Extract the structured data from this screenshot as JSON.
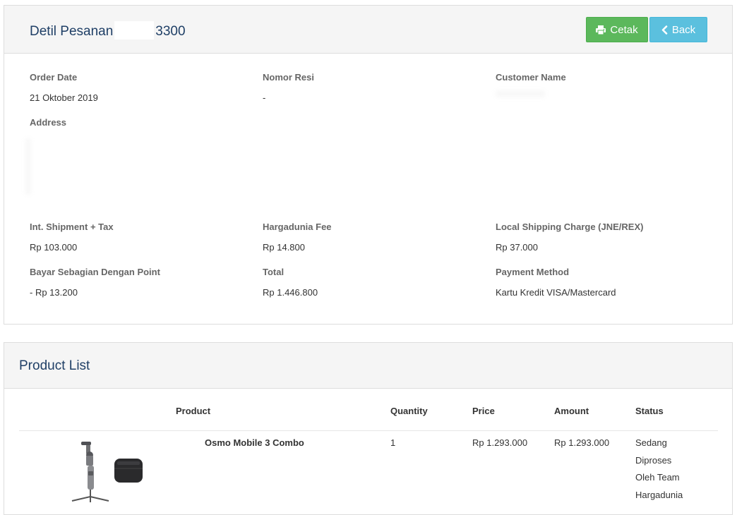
{
  "order": {
    "title_prefix": "Detil Pesanan",
    "title_suffix": "3300",
    "buttons": {
      "print_label": "Cetak",
      "back_label": "Back"
    },
    "fields": {
      "order_date_label": "Order Date",
      "order_date_value": "21 Oktober 2019",
      "nomor_resi_label": "Nomor Resi",
      "nomor_resi_value": "-",
      "customer_name_label": "Customer Name",
      "address_label": "Address",
      "int_shipment_label": "Int. Shipment + Tax",
      "int_shipment_value": "Rp 103.000",
      "hargadunia_fee_label": "Hargadunia Fee",
      "hargadunia_fee_value": "Rp 14.800",
      "local_shipping_label": "Local Shipping Charge (JNE/REX)",
      "local_shipping_value": "Rp 37.000",
      "points_label": "Bayar Sebagian Dengan Point",
      "points_value": "- Rp 13.200",
      "total_label": "Total",
      "total_value": "Rp 1.446.800",
      "payment_label": "Payment Method",
      "payment_value": "Kartu Kredit VISA/Mastercard"
    }
  },
  "products": {
    "title": "Product List",
    "columns": [
      "Product",
      "Quantity",
      "Price",
      "Amount",
      "Status"
    ],
    "rows": [
      {
        "name": "Osmo Mobile 3 Combo",
        "quantity": "1",
        "price": "Rp 1.293.000",
        "amount": "Rp 1.293.000",
        "status_lines": [
          "Sedang",
          "Diproses",
          "Oleh Team",
          "Hargadunia"
        ]
      }
    ]
  },
  "colors": {
    "cetak": "#5cb85c",
    "back": "#5bc0de",
    "title": "#1f3f66"
  },
  "icons": {
    "print": "printer-icon",
    "back": "chevron-left-icon"
  }
}
